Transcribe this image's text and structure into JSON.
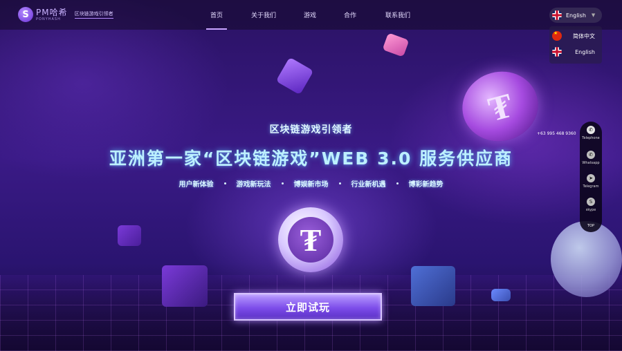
{
  "header": {
    "logo_mark": "S",
    "logo_name": "PM哈希",
    "logo_sub": "PONYHASH",
    "logo_tag": "区块链游戏引领者",
    "nav": [
      {
        "label": "首页",
        "active": true
      },
      {
        "label": "关于我们",
        "active": false
      },
      {
        "label": "游戏",
        "active": false
      },
      {
        "label": "合作",
        "active": false
      },
      {
        "label": "联系我们",
        "active": false
      }
    ],
    "language": {
      "current": "English",
      "caret": "▼",
      "options": [
        {
          "label": "简体中文",
          "flag": "cn-flag-icon"
        },
        {
          "label": "English",
          "flag": "uk-flag-icon"
        }
      ]
    }
  },
  "hero": {
    "subtitle": "区块链游戏引领者",
    "title": "亚洲第一家“区块链游戏”WEB 3.0 服务供应商",
    "features": [
      "用户新体验",
      "游戏新玩法",
      "博娱新市场",
      "行业新机遇",
      "博彩新趋势"
    ],
    "cta_label": "立即试玩",
    "coin_symbol": "₮"
  },
  "contact": {
    "phone": "+63 995 468 9360",
    "dock": [
      {
        "label": "Telephone",
        "icon": "phone-icon",
        "glyph": "✆"
      },
      {
        "label": "Whatsapp",
        "icon": "whatsapp-icon",
        "glyph": "✆"
      },
      {
        "label": "Telegram",
        "icon": "telegram-icon",
        "glyph": "➤"
      },
      {
        "label": "skype",
        "icon": "skype-icon",
        "glyph": "S"
      }
    ],
    "top_label": "TOP"
  },
  "colors": {
    "accent": "#8a5cf0",
    "background": "#2a1263",
    "title_glow": "#bdf0ff"
  }
}
